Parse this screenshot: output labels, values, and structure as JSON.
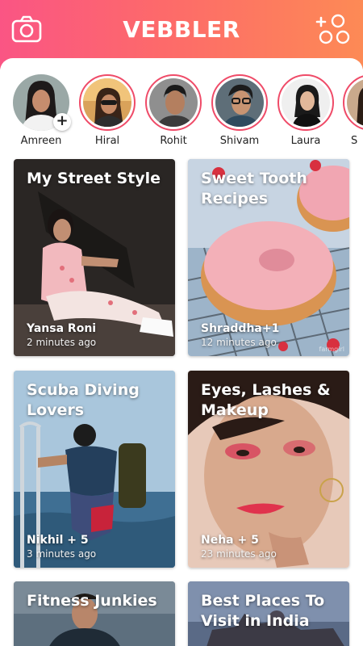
{
  "header": {
    "title": "VEBBLER",
    "camera_icon": "camera-icon",
    "groups_icon": "add-group-icon",
    "gradient": [
      "#fa5584",
      "#fd8a55"
    ]
  },
  "stories": [
    {
      "name": "Amreen",
      "self": true
    },
    {
      "name": "Hiral"
    },
    {
      "name": "Rohit"
    },
    {
      "name": "Shivam"
    },
    {
      "name": "Laura"
    },
    {
      "name": "S"
    }
  ],
  "cards": [
    {
      "title": "My Street Style",
      "author": "Yansa Roni",
      "time": "2 minutes ago"
    },
    {
      "title": "Sweet Tooth Recipes",
      "author": "Shraddha+1",
      "time": "12 minutes ago",
      "watermark": "farmgirl"
    },
    {
      "title": "Scuba Diving Lovers",
      "author": "Nikhil + 5",
      "time": "3 minutes ago"
    },
    {
      "title": "Eyes, Lashes & Makeup",
      "author": "Neha + 5",
      "time": "23 minutes ago"
    },
    {
      "title": "Fitness Junkies"
    },
    {
      "title": "Best Places To Visit in India"
    }
  ],
  "colors": {
    "story_ring": "#ef4b68"
  }
}
